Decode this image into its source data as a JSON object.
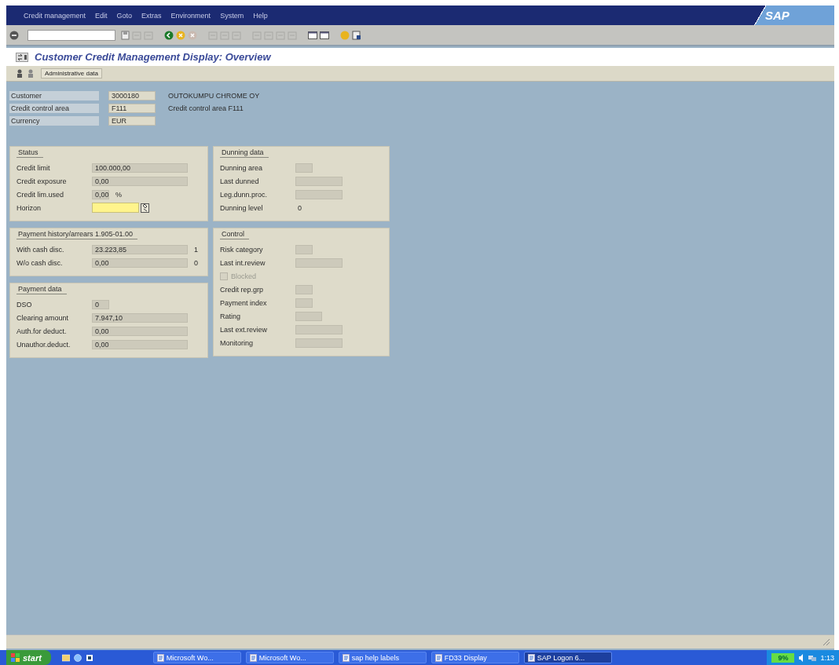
{
  "menu": [
    {
      "label": "Credit management"
    },
    {
      "label": "Edit"
    },
    {
      "label": "Goto"
    },
    {
      "label": "Extras"
    },
    {
      "label": "Environment"
    },
    {
      "label": "System"
    },
    {
      "label": "Help"
    }
  ],
  "logo": "SAP",
  "title": "Customer Credit Management Display: Overview",
  "app_toolbar": {
    "buttons": [
      "Administrative data"
    ]
  },
  "header_fields": [
    {
      "label": "Customer",
      "value": "3000180",
      "description": "OUTOKUMPU CHROME OY"
    },
    {
      "label": "Credit control area",
      "value": "F111",
      "description": "Credit control area F111"
    },
    {
      "label": "Currency",
      "value": "EUR"
    }
  ],
  "columns": [
    [
      {
        "title": "Status",
        "rows": [
          {
            "kind": "amount",
            "label": "Credit limit",
            "value": "100.000,00"
          },
          {
            "kind": "amount",
            "label": "Credit exposure",
            "value": "0,00"
          },
          {
            "kind": "short",
            "label": "Credit lim.used",
            "value": "0,00",
            "unit": "%"
          },
          {
            "kind": "input",
            "label": "Horizon",
            "focused": true
          }
        ]
      },
      {
        "title": "Payment history/arrears 1.905-01.00",
        "rows": [
          {
            "kind": "amount",
            "label": "With cash disc.",
            "value": "23.223,85",
            "unit": "1"
          },
          {
            "kind": "amount",
            "label": "W/o cash disc.",
            "value": "0,00",
            "unit": "0"
          }
        ]
      },
      {
        "title": "Payment data",
        "rows": [
          {
            "kind": "short",
            "label": "DSO",
            "value": "0"
          },
          {
            "kind": "amount",
            "label": "Clearing amount",
            "value": "7.947,10"
          },
          {
            "kind": "amount",
            "label": "Auth.for deduct.",
            "value": "0,00"
          },
          {
            "kind": "amount",
            "label": "Unauthor.deduct.",
            "value": "0,00"
          }
        ]
      }
    ],
    [
      {
        "title": "Dunning data",
        "rows": [
          {
            "kind": "short",
            "label": "Dunning area"
          },
          {
            "kind": "medium",
            "label": "Last dunned"
          },
          {
            "kind": "medium",
            "label": "Leg.dunn.proc."
          },
          {
            "kind": "plain",
            "label": "Dunning level",
            "value": "0"
          }
        ]
      },
      {
        "title": "Control",
        "rows": [
          {
            "kind": "short",
            "label": "Risk category"
          },
          {
            "kind": "medium",
            "label": "Last int.review"
          },
          {
            "kind": "checkbox",
            "label": "Blocked",
            "checked": false,
            "disabled": true
          },
          {
            "kind": "short",
            "label": "Credit rep.grp"
          },
          {
            "kind": "short",
            "label": "Payment index"
          },
          {
            "kind": "small",
            "label": "Rating"
          },
          {
            "kind": "medium",
            "label": "Last ext.review"
          },
          {
            "kind": "medium",
            "label": "Monitoring"
          }
        ]
      }
    ]
  ],
  "taskbar": {
    "start": "start",
    "windows": [
      {
        "label": "Microsoft Wo...",
        "selected": false
      },
      {
        "label": "Microsoft Wo...",
        "selected": false
      },
      {
        "label": "sap help labels",
        "selected": false
      },
      {
        "label": "FD33 Display",
        "selected": false
      },
      {
        "label": "SAP Logon 6...",
        "selected": true
      }
    ],
    "tray_badge": "9%",
    "clock": "1:13"
  }
}
